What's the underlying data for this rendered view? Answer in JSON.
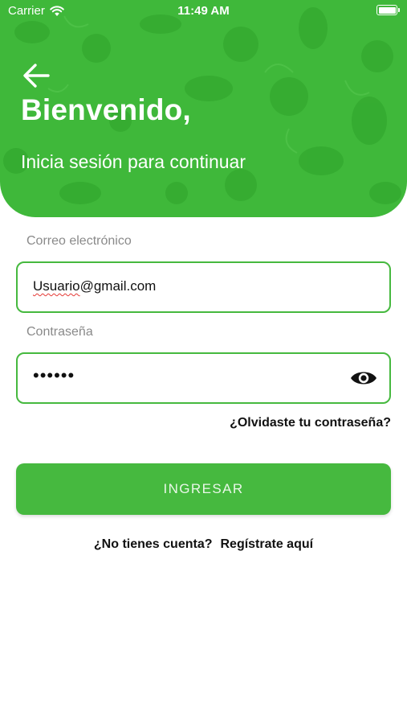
{
  "status_bar": {
    "carrier": "Carrier",
    "time": "11:49 AM"
  },
  "header": {
    "title": "Bienvenido,",
    "subtitle": "Inicia sesión para continuar",
    "background_color": "#3fb83a"
  },
  "form": {
    "email": {
      "label": "Correo electrónico",
      "value_underlined": "Usuario",
      "value_rest": "@gmail.com"
    },
    "password": {
      "label": "Contraseña",
      "masked_value": "••••••"
    },
    "forgot_password": "¿Olvidaste tu contraseña?",
    "submit_label": "INGRESAR"
  },
  "signup": {
    "prompt": "¿No tienes cuenta?",
    "link": "Regístrate aquí"
  },
  "colors": {
    "accent": "#46b93f",
    "spellcheck": "#e53935"
  },
  "icons": [
    "wifi-icon",
    "battery-icon",
    "back-arrow-icon",
    "eye-icon"
  ]
}
